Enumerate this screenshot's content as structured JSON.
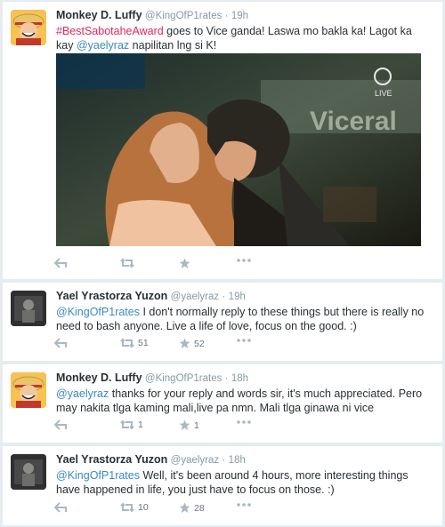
{
  "colors": {
    "link": "#e0245e",
    "mention": "#3b88c3",
    "text": "#292f33",
    "muted": "#8899a6"
  },
  "tweets": [
    {
      "name": "Monkey D. Luffy",
      "handle": "@KingOfP1rates",
      "sep": "·",
      "time": "19h",
      "hashtag": "#BestSabotaheAward",
      "text_a": " goes to Vice ganda! Laswa mo bakla ka! Lagot ka kay ",
      "mention": "@yaelyraz",
      "text_b": " napilitan lng si K!",
      "media": {
        "watermark": "LIVE",
        "screen_text": "Viceral"
      },
      "retweets": "",
      "favorites": ""
    },
    {
      "name": "Yael Yrastorza Yuzon",
      "handle": "@yaelyraz",
      "sep": "·",
      "time": "19h",
      "mention": "@KingOfP1rates",
      "text": " I don't normally reply to these things but there is really no need to bash anyone. Live a life of love, focus on the good. :)",
      "retweets": "51",
      "favorites": "52"
    },
    {
      "name": "Monkey D. Luffy",
      "handle": "@KingOfP1rates",
      "sep": "·",
      "time": "18h",
      "mention": "@yaelyraz",
      "text": " thanks for your reply and words sir, it's much appreciated. Pero may nakita tlga kaming mali,live pa nmn. Mali tlga ginawa ni vice",
      "retweets": "1",
      "favorites": "1"
    },
    {
      "name": "Yael Yrastorza Yuzon",
      "handle": "@yaelyraz",
      "sep": "·",
      "time": "18h",
      "mention": "@KingOfP1rates",
      "text": " Well, it's been around 4 hours, more interesting things have happened in life, you just have to focus on those. :)",
      "retweets": "10",
      "favorites": "28"
    }
  ]
}
